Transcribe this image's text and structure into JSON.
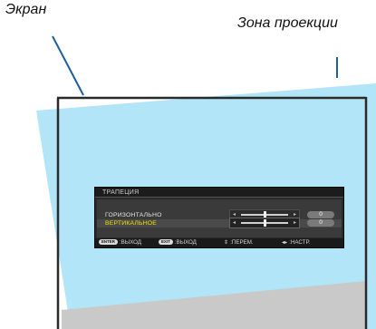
{
  "labels": {
    "screen": "Экран",
    "projection_area": "Зона проекции"
  },
  "osd": {
    "title": "ТРАПЕЦИЯ",
    "rows": [
      {
        "label": "ГОРИЗОНТАЛЬНО",
        "value": "0",
        "level": 0.5,
        "selected": false
      },
      {
        "label": "ВЕРТИКАЛЬНОЕ",
        "value": "0",
        "level": 0.5,
        "selected": true
      }
    ],
    "footer": {
      "enter_key": "ENTER",
      "enter_text": ":ВЫХОД",
      "exit_key": "EXIT",
      "exit_text": ":ВЫХОД",
      "move_glyph": "⇕",
      "move_text": ":ПЕРЕМ.",
      "adjust_glyph": "◂▸",
      "adjust_text": ":НАСТР."
    }
  },
  "colors": {
    "projection_fill": "#b3e5f8",
    "screen_shadow": "#c9c9c9",
    "screen_border": "#2a2a2a",
    "callout_line": "#1f5fa0",
    "highlight_text": "#f2e400"
  }
}
